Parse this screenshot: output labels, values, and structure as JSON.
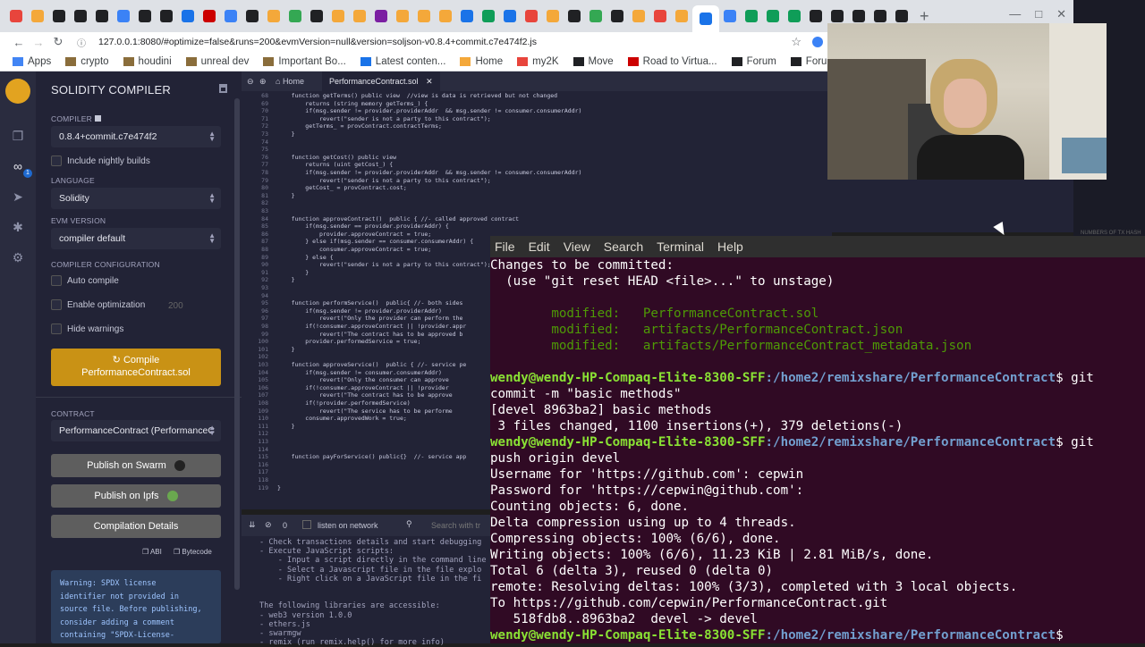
{
  "browser": {
    "url": "127.0.0.1:8080/#optimize=false&runs=200&evmVersion=null&version=soljson-v0.8.4+commit.c7e474f2.js",
    "bookmarks": [
      "Apps",
      "crypto",
      "houdini",
      "unreal dev",
      "Important Bo...",
      "Latest conten...",
      "Home",
      "my2K",
      "Move",
      "Road to Virtua...",
      "Forum",
      "Forums | Film"
    ],
    "tab_colors": [
      "#e8453c",
      "#f4a83a",
      "#202124",
      "#202124",
      "#202124",
      "#3b82f6",
      "#202124",
      "#202124",
      "#1a73e8",
      "#c00",
      "#3b82f6",
      "#202124",
      "#f4a83a",
      "#34a853",
      "#202124",
      "#f4a83a",
      "#f4a83a",
      "#7b1fa2",
      "#f4a83a",
      "#f4a83a",
      "#f4a83a",
      "#1a73e8",
      "#0f9d58",
      "#1a73e8",
      "#e8453c",
      "#f4a83a",
      "#202124",
      "#34a853",
      "#202124",
      "#f4a83a",
      "#e8453c",
      "#f4a83a",
      "#1a73e8",
      "#3b82f6",
      "#0f9d58",
      "#0f9d58",
      "#0f9d58",
      "#202124",
      "#202124",
      "#202124",
      "#202124",
      "#202124"
    ]
  },
  "compiler": {
    "title": "SOLIDITY COMPILER",
    "compiler_label": "COMPILER",
    "compiler_version": "0.8.4+commit.c7e474f2",
    "nightly_label": "Include nightly builds",
    "language_label": "LANGUAGE",
    "language": "Solidity",
    "evm_label": "EVM VERSION",
    "evm": "compiler default",
    "config_label": "COMPILER CONFIGURATION",
    "auto_compile": "Auto compile",
    "optimization": "Enable optimization",
    "runs": "200",
    "hide_warnings": "Hide warnings",
    "compile_btn_line1": "Compile",
    "compile_btn_line2": "PerformanceContract.sol",
    "contract_label": "CONTRACT",
    "contract": "PerformanceContract (PerformanceC",
    "swarm": "Publish on Swarm",
    "ipfs": "Publish on Ipfs",
    "details": "Compilation Details",
    "abi": "ABI",
    "bytecode": "Bytecode",
    "warning": "Warning: SPDX license\nidentifier not provided in\nsource file. Before publishing,\nconsider adding a comment\ncontaining \"SPDX-License-\nIdentifier: <SPDX-License> to"
  },
  "editor": {
    "tab_home": "Home",
    "tab_file": "PerformanceContract.sol",
    "lines": [
      {
        "n": "68",
        "t": "    function getTerms() public view  //view is data is retrieved but not changed"
      },
      {
        "n": "69",
        "t": "        returns (string memory getTerms_) {"
      },
      {
        "n": "70",
        "t": "        if(msg.sender != provider.providerAddr  && msg.sender != consumer.consumerAddr)"
      },
      {
        "n": "71",
        "t": "            revert(\"sender is not a party to this contract\");"
      },
      {
        "n": "72",
        "t": "        getTerms_ = provContract.contractTerms;"
      },
      {
        "n": "73",
        "t": "    }"
      },
      {
        "n": "74",
        "t": ""
      },
      {
        "n": "75",
        "t": ""
      },
      {
        "n": "76",
        "t": "    function getCost() public view"
      },
      {
        "n": "77",
        "t": "        returns (uint getCost_) {"
      },
      {
        "n": "78",
        "t": "        if(msg.sender != provider.providerAddr  && msg.sender != consumer.consumerAddr)"
      },
      {
        "n": "79",
        "t": "            revert(\"sender is not a party to this contract\");"
      },
      {
        "n": "80",
        "t": "        getCost_ = provContract.cost;"
      },
      {
        "n": "81",
        "t": "    }"
      },
      {
        "n": "82",
        "t": ""
      },
      {
        "n": "83",
        "t": ""
      },
      {
        "n": "84",
        "t": "    function approveContract()  public { //- called approved contract"
      },
      {
        "n": "85",
        "t": "        if(msg.sender == provider.providerAddr) {"
      },
      {
        "n": "86",
        "t": "            provider.approveContract = true;"
      },
      {
        "n": "87",
        "t": "        } else if(msg.sender == consumer.consumerAddr) {"
      },
      {
        "n": "88",
        "t": "            consumer.approveContract = true;"
      },
      {
        "n": "89",
        "t": "        } else {"
      },
      {
        "n": "90",
        "t": "            revert(\"sender is not a party to this contract\");"
      },
      {
        "n": "91",
        "t": "        }"
      },
      {
        "n": "92",
        "t": "    }"
      },
      {
        "n": "93",
        "t": ""
      },
      {
        "n": "94",
        "t": ""
      },
      {
        "n": "95",
        "t": "    function performService()  public{ //- both sides"
      },
      {
        "n": "96",
        "t": "        if(msg.sender != provider.providerAddr)"
      },
      {
        "n": "97",
        "t": "            revert(\"Only the provider can perform the"
      },
      {
        "n": "98",
        "t": "        if(!consumer.approveContract || !provider.appr"
      },
      {
        "n": "99",
        "t": "            revert(\"The contract has to be approved b"
      },
      {
        "n": "100",
        "t": "        provider.performedService = true;"
      },
      {
        "n": "101",
        "t": "    }"
      },
      {
        "n": "102",
        "t": ""
      },
      {
        "n": "103",
        "t": "    function approveService()  public { //- service pe"
      },
      {
        "n": "104",
        "t": "        if(msg.sender != consumer.consumerAddr)"
      },
      {
        "n": "105",
        "t": "            revert(\"Only the consumer can approve"
      },
      {
        "n": "106",
        "t": "        if(!consumer.approveContract || !provider"
      },
      {
        "n": "107",
        "t": "            revert(\"The contract has to be approve"
      },
      {
        "n": "108",
        "t": "        if(!provider.performedService)"
      },
      {
        "n": "109",
        "t": "            revert(\"The service has to be performe"
      },
      {
        "n": "110",
        "t": "        consumer.approvedWork = true;"
      },
      {
        "n": "111",
        "t": "    }"
      },
      {
        "n": "112",
        "t": ""
      },
      {
        "n": "113",
        "t": ""
      },
      {
        "n": "114",
        "t": ""
      },
      {
        "n": "115",
        "t": "    function payForService() public{}  //- service app"
      },
      {
        "n": "116",
        "t": ""
      },
      {
        "n": "117",
        "t": ""
      },
      {
        "n": "118",
        "t": ""
      },
      {
        "n": "119",
        "t": "}"
      }
    ]
  },
  "remix_terminal": {
    "counter": "0",
    "listen": "listen on network",
    "search": "Search with tr",
    "text": "- Check transactions details and start debugging\n- Execute JavaScript scripts:\n    - Input a script directly in the command line\n    - Select a Javascript file in the file explo\n    - Right click on a JavaScript file in the fi\n\n\nThe following libraries are accessible:\n- web3 version 1.0.0\n- ethers.js\n- swarmgw\n- remix (run remix.help() for more info)"
  },
  "gnome_terminal": {
    "menu": [
      "File",
      "Edit",
      "View",
      "Search",
      "Terminal",
      "Help"
    ],
    "line1": "Changes to be committed:",
    "line2": "  (use \"git reset HEAD <file>...\" to unstage)",
    "modified_label": "modified:",
    "modified_files": [
      "PerformanceContract.sol",
      "artifacts/PerformanceContract.json",
      "artifacts/PerformanceContract_metadata.json"
    ],
    "prompt_user": "wendy@wendy-HP-Compaq-Elite-8300-SFF",
    "prompt_path": ":/home2/remixshare/PerformanceContract",
    "cmd1a": "$ git",
    "cmd1b": "commit -m \"basic methods\"",
    "out1": "[devel 8963ba2] basic methods",
    "out2": " 3 files changed, 1100 insertions(+), 379 deletions(-)",
    "cmd2a": "$ git",
    "cmd2b": "push origin devel",
    "out3": "Username for 'https://github.com': cepwin",
    "out4": "Password for 'https://cepwin@github.com':",
    "out5": "Counting objects: 6, done.",
    "out6": "Delta compression using up to 4 threads.",
    "out7": "Compressing objects: 100% (6/6), done.",
    "out8": "Writing objects: 100% (6/6), 11.23 KiB | 2.81 MiB/s, done.",
    "out9": "Total 6 (delta 3), reused 0 (delta 0)",
    "out10": "remote: Resolving deltas: 100% (3/3), completed with 3 local objects.",
    "out11": "To https://github.com/cepwin/PerformanceContract.git",
    "out12": "   518fdb8..8963ba2  devel -> devel",
    "last_suffix": "$ "
  },
  "right_strip": {
    "label": "NUMBERS OF TX HASH"
  }
}
